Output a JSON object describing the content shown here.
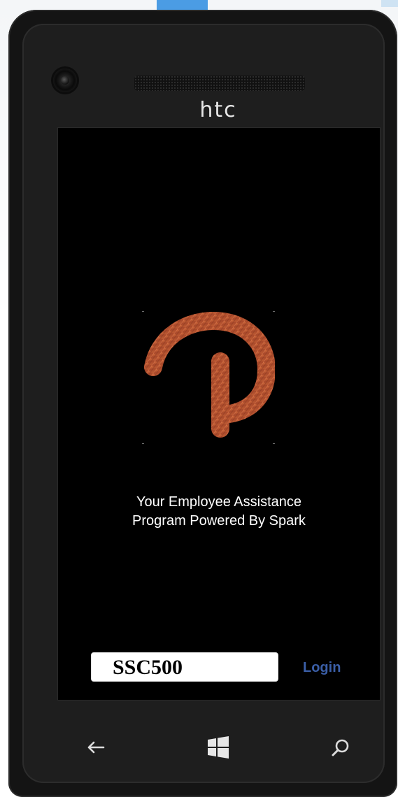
{
  "device": {
    "brand": "htc"
  },
  "app": {
    "tagline_line1": "Your Employee Assistance",
    "tagline_line2": "Program Powered By Spark",
    "code_input": {
      "value": "SSC500",
      "placeholder": ""
    },
    "login_label": "Login",
    "logo_icon": "spark-p-logo-icon"
  },
  "nav": {
    "back_icon": "back-arrow-icon",
    "start_icon": "windows-start-icon",
    "search_icon": "search-icon"
  },
  "colors": {
    "screen_bg": "#000000",
    "login_link": "#3b5fa8",
    "logo_fill": "#b0552a"
  }
}
